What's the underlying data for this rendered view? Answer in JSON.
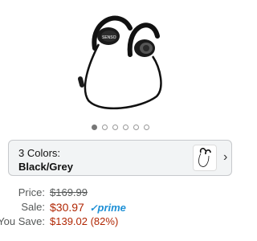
{
  "product": {
    "image_icon": "black-grey-sport-earbuds",
    "brand_on_earbud": "SENSO",
    "gallery_total": 6,
    "gallery_active_index": 0
  },
  "variant": {
    "count_label": "3 Colors:",
    "selected_name": "Black/Grey",
    "thumb_icon": "earbuds-thumbnail",
    "chevron_icon": "chevron-right-icon"
  },
  "pricing": {
    "price_label": "Price:",
    "list_price": "$169.99",
    "sale_label": "Sale:",
    "sale_price": "$30.97",
    "prime_label": "prime",
    "savings_label": "You Save:",
    "savings_value": "$139.02 (82%)"
  },
  "colors": {
    "sale_red": "#b12704",
    "prime_blue": "#1e90d6",
    "stock_green": "#007600",
    "variant_bg": "#f2f4f5"
  }
}
